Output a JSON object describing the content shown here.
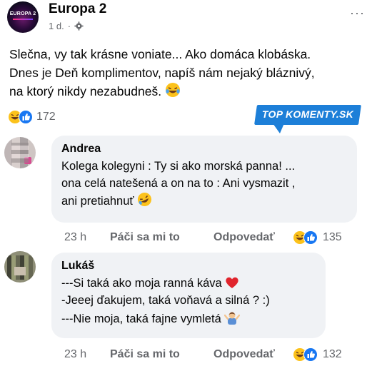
{
  "post": {
    "page_name": "Europa 2",
    "logo_text": "EUROPA 2",
    "time": "1 d.",
    "separator": "·",
    "more": "···",
    "text_lines": [
      "Slečna, vy tak krásne voniate... Ako domáca klobáska.",
      "Dnes je Deň komplimentov, napíš nám nejaký bláznivý,",
      "na ktorý nikdy nezabudneš."
    ],
    "reaction_count": "172"
  },
  "badge": {
    "text": "TOP KOMENTY.SK"
  },
  "comments": [
    {
      "name": "Andrea",
      "lines": [
        "Kolega kolegyni : Ty si ako morská panna! ...",
        "ona celá natešená a on na to : Ani vysmazit ,",
        "ani pretiahnuť"
      ],
      "time": "23 h",
      "like": "Páči sa mi to",
      "reply": "Odpovedať",
      "reaction_count": "135"
    },
    {
      "name": "Lukáš",
      "lines": [
        "---Si taká ako moja ranná káva",
        "-Jeeej ďakujem, taká voňavá a silná ? :)",
        "---Nie moja, taká fajne vymletá"
      ],
      "time": "23 h",
      "like": "Páči sa mi to",
      "reply": "Odpovedať",
      "reaction_count": "132"
    }
  ],
  "colors": {
    "like_blue": "#1877f2",
    "badge_blue": "#1d7fd8",
    "bubble": "#f0f2f5",
    "meta": "#65676b"
  }
}
